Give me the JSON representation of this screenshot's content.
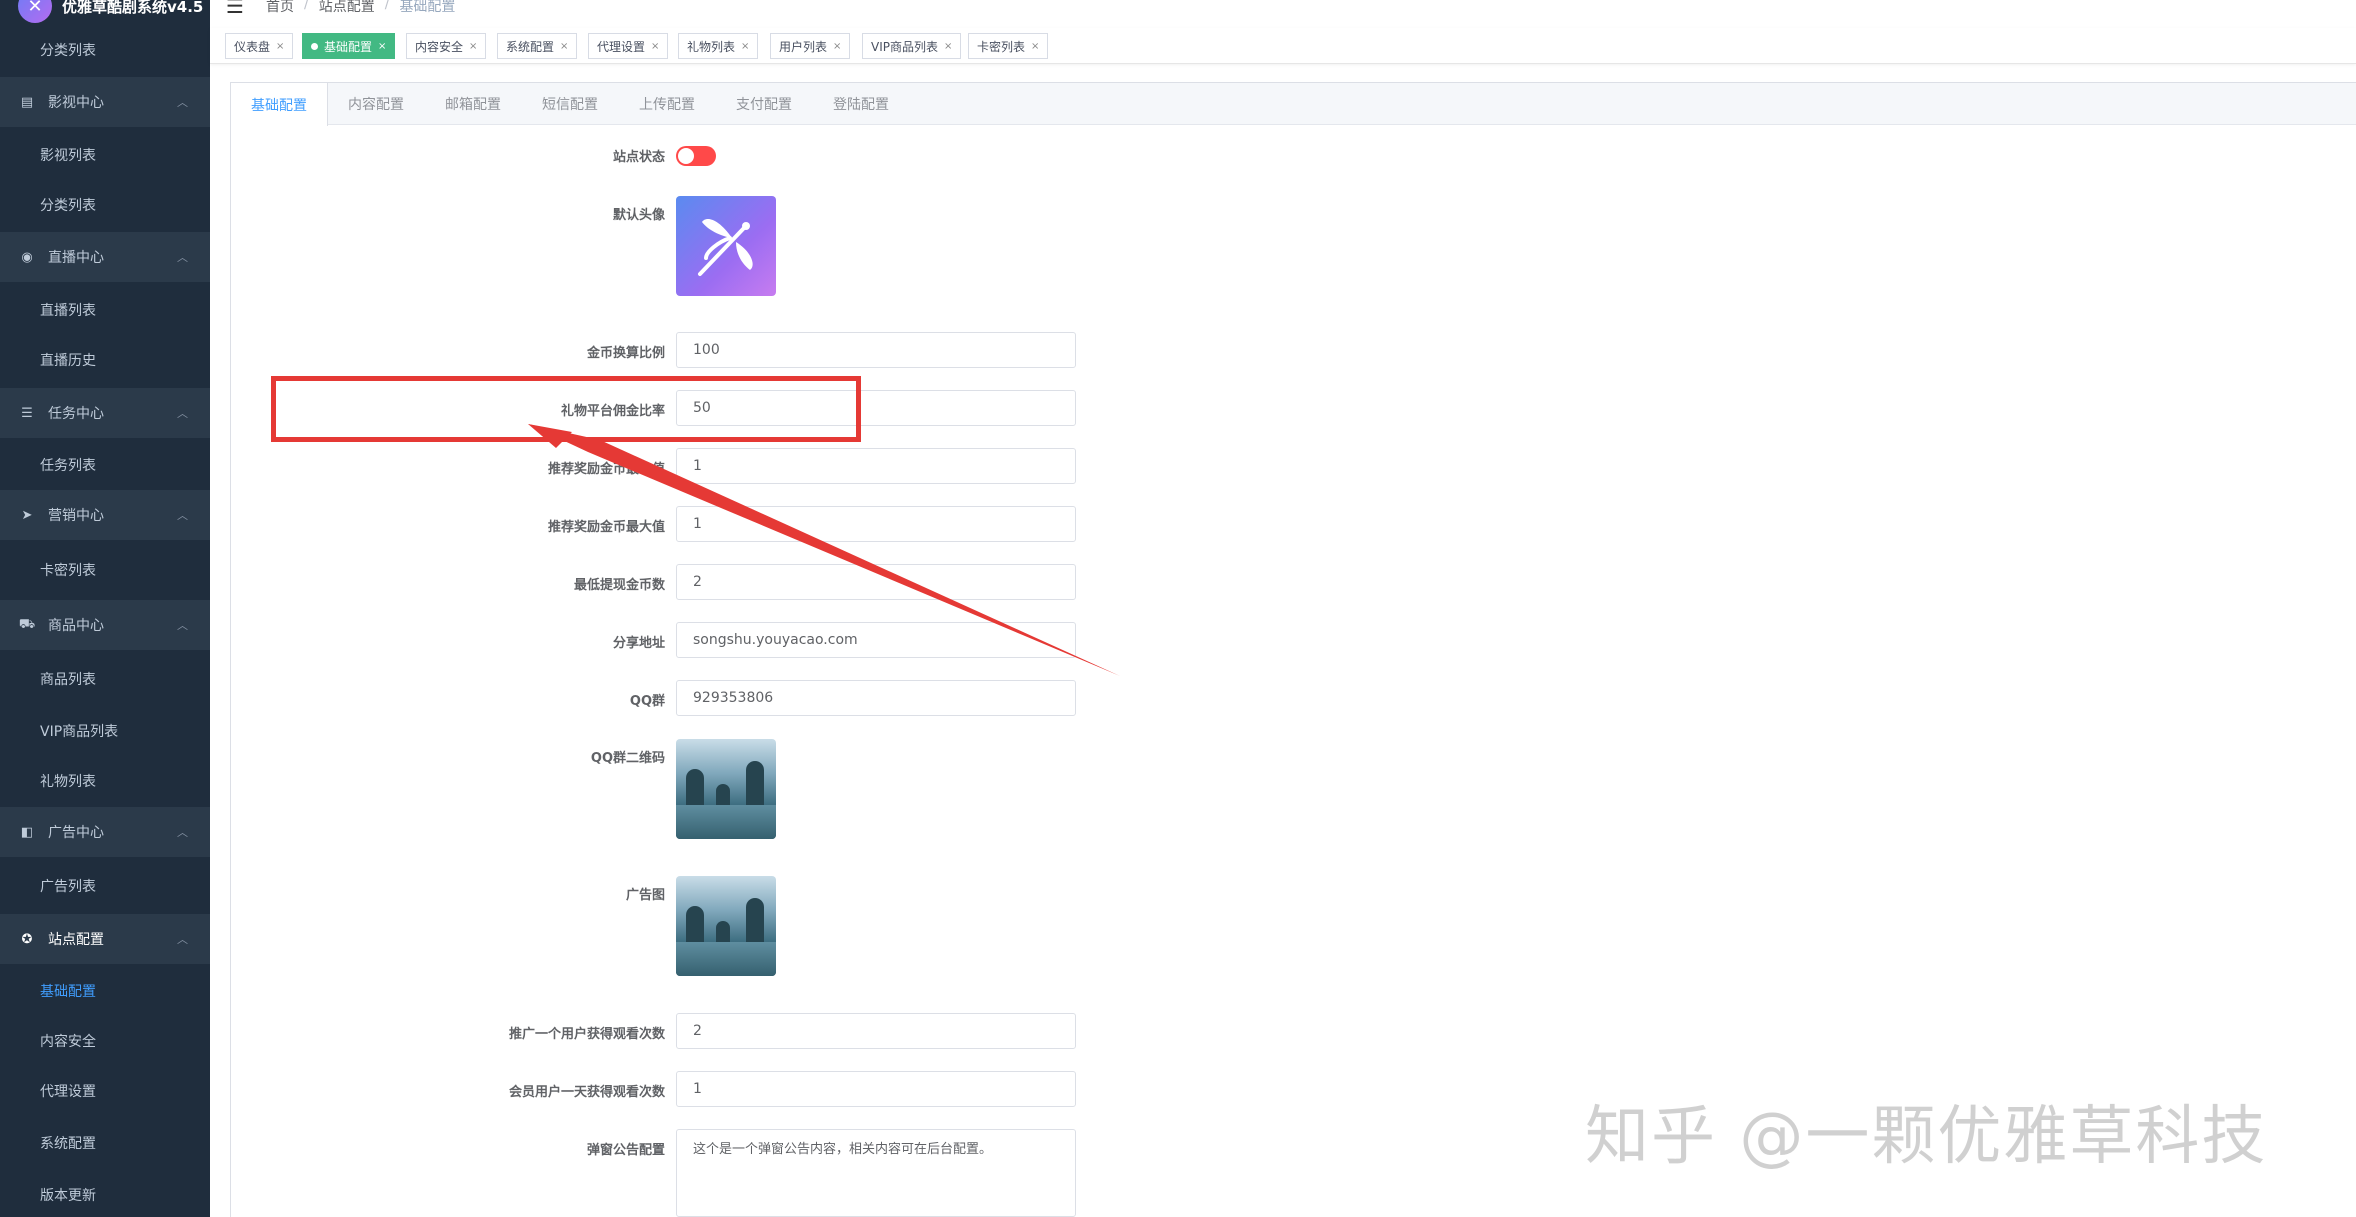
{
  "app": {
    "title": "优雅草酷剧系统v4.5"
  },
  "breadcrumb": [
    "首页",
    "站点配置",
    "基础配置"
  ],
  "tags": [
    {
      "label": "仪表盘",
      "active": false
    },
    {
      "label": "基础配置",
      "active": true
    },
    {
      "label": "内容安全",
      "active": false
    },
    {
      "label": "系统配置",
      "active": false
    },
    {
      "label": "代理设置",
      "active": false
    },
    {
      "label": "礼物列表",
      "active": false
    },
    {
      "label": "用户列表",
      "active": false
    },
    {
      "label": "VIP商品列表",
      "active": false
    },
    {
      "label": "卡密列表",
      "active": false
    }
  ],
  "sidebar": {
    "items": [
      {
        "type": "sub",
        "label": "分类列表"
      },
      {
        "type": "group",
        "label": "影视中心",
        "icon": "book-icon"
      },
      {
        "type": "sub",
        "label": "影视列表"
      },
      {
        "type": "sub",
        "label": "分类列表"
      },
      {
        "type": "group",
        "label": "直播中心",
        "icon": "globe-icon"
      },
      {
        "type": "sub",
        "label": "直播列表"
      },
      {
        "type": "sub",
        "label": "直播历史"
      },
      {
        "type": "group",
        "label": "任务中心",
        "icon": "list-icon"
      },
      {
        "type": "sub",
        "label": "任务列表"
      },
      {
        "type": "group",
        "label": "营销中心",
        "icon": "send-icon"
      },
      {
        "type": "sub",
        "label": "卡密列表"
      },
      {
        "type": "group",
        "label": "商品中心",
        "icon": "cart-icon"
      },
      {
        "type": "sub",
        "label": "商品列表"
      },
      {
        "type": "sub",
        "label": "VIP商品列表"
      },
      {
        "type": "sub",
        "label": "礼物列表"
      },
      {
        "type": "group",
        "label": "广告中心",
        "icon": "ad-icon"
      },
      {
        "type": "sub",
        "label": "广告列表"
      },
      {
        "type": "group",
        "label": "站点配置",
        "icon": "settings-icon",
        "strong": true
      },
      {
        "type": "sub",
        "label": "基础配置",
        "active": true
      },
      {
        "type": "sub",
        "label": "内容安全"
      },
      {
        "type": "sub",
        "label": "代理设置"
      },
      {
        "type": "sub",
        "label": "系统配置"
      },
      {
        "type": "sub",
        "label": "版本更新"
      }
    ]
  },
  "tabs": [
    "基础配置",
    "内容配置",
    "邮箱配置",
    "短信配置",
    "上传配置",
    "支付配置",
    "登陆配置"
  ],
  "form": {
    "site_status_label": "站点状态",
    "site_status_on": false,
    "default_avatar_label": "默认头像",
    "coin_ratio_label": "金币换算比例",
    "coin_ratio": "100",
    "gift_commission_label": "礼物平台佣金比率",
    "gift_commission": "50",
    "reward_min_label": "推荐奖励金币最小值",
    "reward_min": "1",
    "reward_max_label": "推荐奖励金币最大值",
    "reward_max": "1",
    "min_withdraw_label": "最低提现金币数",
    "min_withdraw": "2",
    "share_url_label": "分享地址",
    "share_url": "songshu.youyacao.com",
    "qq_group_label": "QQ群",
    "qq_group": "929353806",
    "qq_qrcode_label": "QQ群二维码",
    "ad_image_label": "广告图",
    "promote_views_label": "推广一个用户获得观看次数",
    "promote_views": "2",
    "vip_daily_views_label": "会员用户一天获得观看次数",
    "vip_daily_views": "1",
    "popup_notice_label": "弹窗公告配置",
    "popup_notice": "这个是一个弹窗公告内容，相关内容可在后台配置。"
  },
  "watermark": "知乎 @一颗优雅草科技",
  "colors": {
    "accent": "#409eff",
    "tag_active": "#42b983",
    "highlight": "#e53935",
    "toggle_off": "#ff4949"
  }
}
